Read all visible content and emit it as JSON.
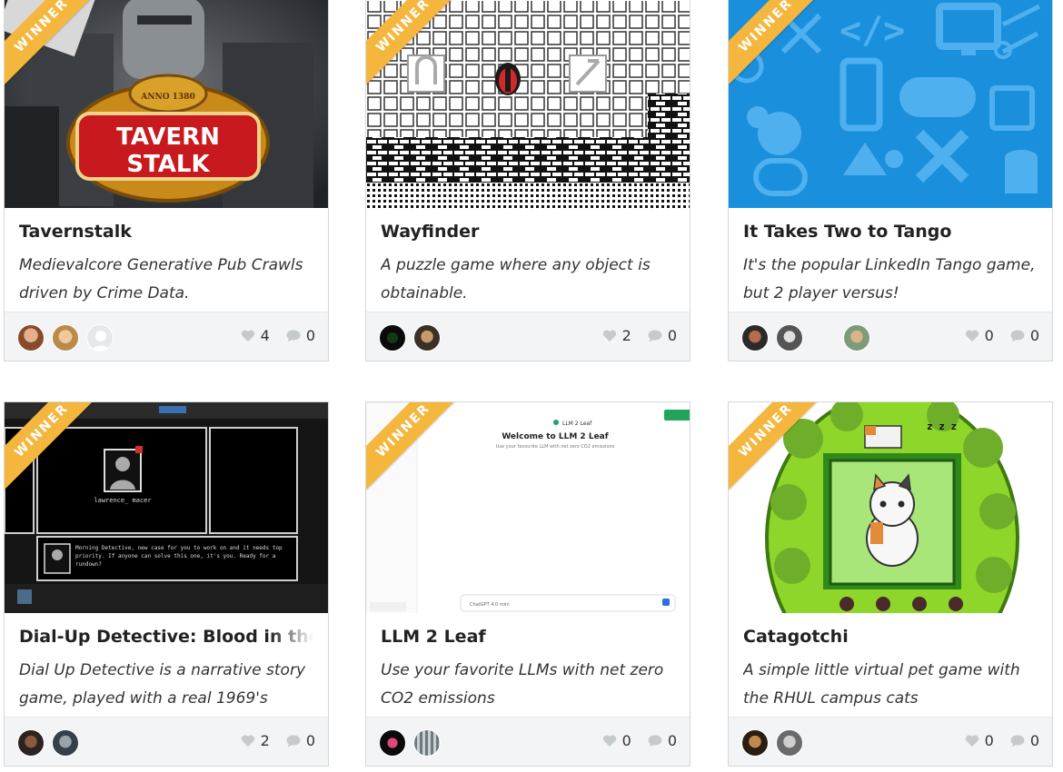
{
  "ribbon_label": "WINNER",
  "colors": {
    "ribbon": "#f4b63d",
    "footer": "#f2f4f5",
    "border": "#d4d7d9"
  },
  "cards": [
    {
      "title": "Tavernstalk",
      "description": "Medievalcore Generative Pub Crawls driven by Crime Data.",
      "thumbnail": {
        "logo_text_1": "TAVERN",
        "logo_text_2": "STALK",
        "logo_small": "ANNO 1380"
      },
      "likes": "4",
      "comments": "0"
    },
    {
      "title": "Wayfinder",
      "description": "A puzzle game where any object is obtainable.",
      "likes": "2",
      "comments": "0"
    },
    {
      "title": "It Takes Two to Tango",
      "description": "It's the popular LinkedIn Tango game, but 2 player versus!",
      "likes": "0",
      "comments": "0"
    },
    {
      "title": "Dial-Up Detective: Blood in the",
      "description": "Dial Up Detective is a narrative story game, played with a real 1969's",
      "thumbnail": {
        "name_label": "lawrence_ macer",
        "dialogue": "Morning Detective, new case for you to work on and it needs top priority. If anyone can solve this one, it's you. Ready for a rundown?"
      },
      "likes": "2",
      "comments": "0"
    },
    {
      "title": "LLM 2 Leaf",
      "description": "Use your favorite LLMs with net zero CO2 emissions",
      "thumbnail": {
        "app_name": "LLM 2 Leaf",
        "welcome": "Welcome to LLM 2 Leaf",
        "subtitle": "Use your favourite LLM with net zero CO2 emissions",
        "model": "ChatGPT 4.0 mini"
      },
      "likes": "0",
      "comments": "0"
    },
    {
      "title": "Catagotchi",
      "description": "A simple little virtual pet game with the RHUL campus cats",
      "thumbnail": {
        "zzz": "z z z"
      },
      "likes": "0",
      "comments": "0"
    }
  ]
}
